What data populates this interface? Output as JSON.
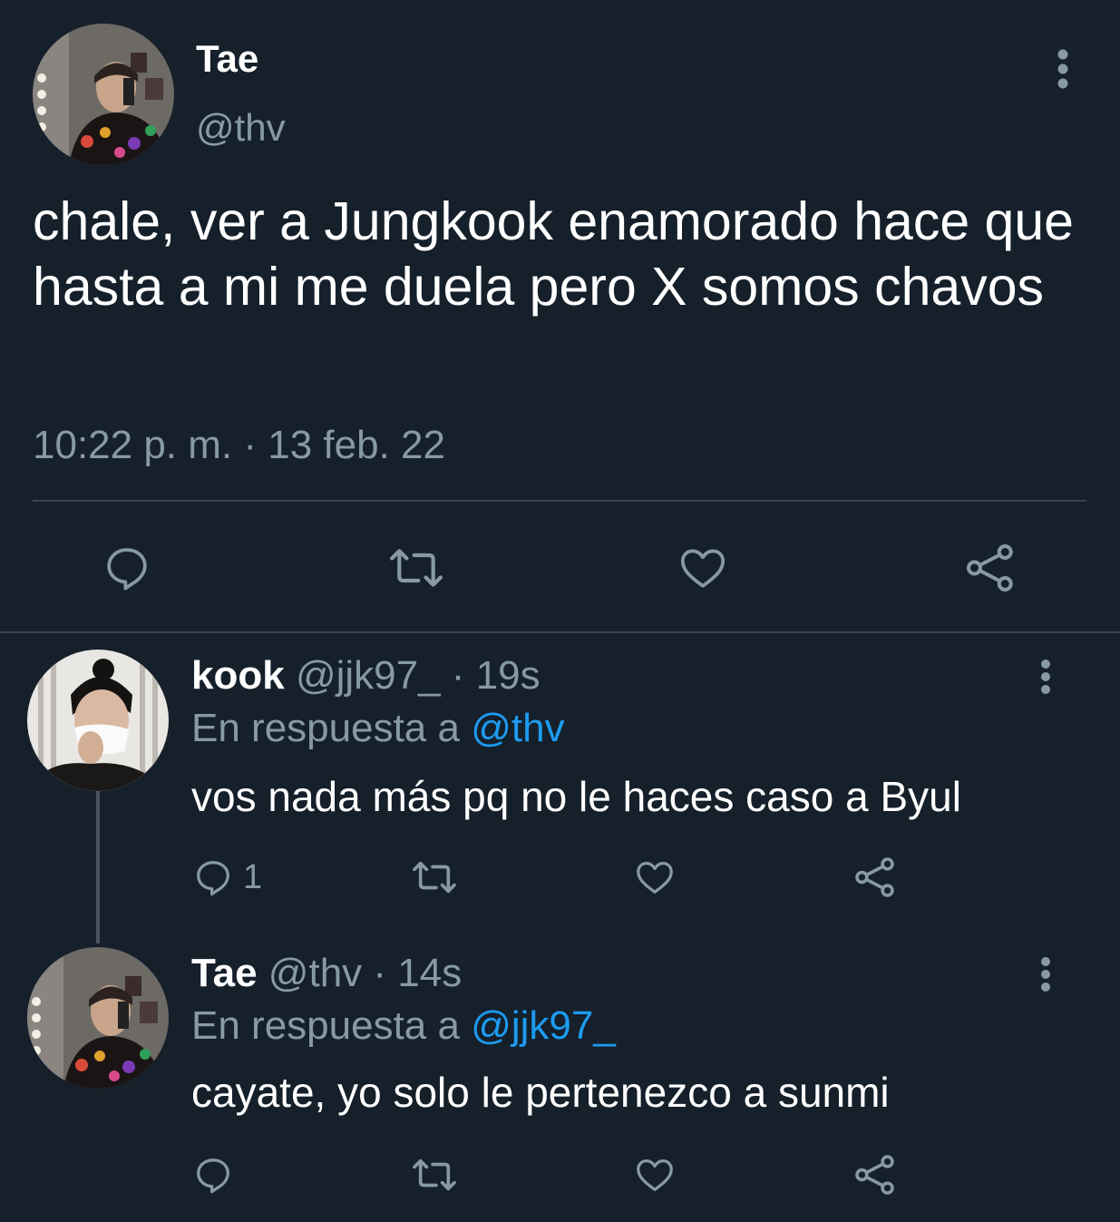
{
  "main_tweet": {
    "avatar": "tae-avatar",
    "display_name": "Tae",
    "handle": "@thv",
    "text": "chale, ver a Jungkook enamorado hace que hasta a mi me duela pero X somos chavos",
    "timestamp": "10:22 p. m. · 13 feb. 22",
    "actions": [
      "reply-icon",
      "retweet-icon",
      "like-icon",
      "share-icon"
    ],
    "more_icon": "more-vertical-icon"
  },
  "replies": [
    {
      "avatar": "kook-avatar",
      "display_name": "kook",
      "handle": "@jjk97_",
      "separator": " · ",
      "time": "19s",
      "reply_prefix": "En respuesta a ",
      "reply_mention": "@thv",
      "text": "vos nada más pq no le haces caso a Byul",
      "reply_count": "1"
    },
    {
      "avatar": "tae-avatar",
      "display_name": "Tae",
      "handle": "@thv",
      "separator": " · ",
      "time": "14s",
      "reply_prefix": "En respuesta a ",
      "reply_mention": "@jjk97_",
      "text": "cayate, yo solo le pertenezco a sunmi"
    }
  ],
  "colors": {
    "background": "#15202b",
    "text_primary": "#ffffff",
    "text_secondary": "#8899a6",
    "link": "#1d9bf0",
    "divider": "#38444d"
  }
}
